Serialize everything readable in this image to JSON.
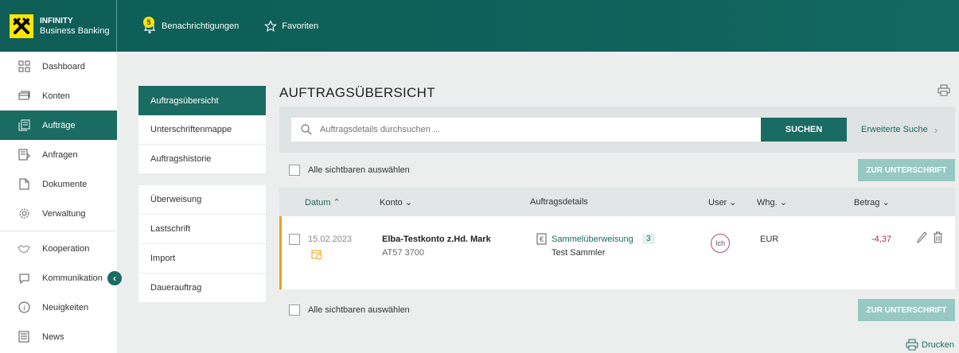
{
  "brand": {
    "line1": "INFINITY",
    "line2": "Business Banking"
  },
  "topnav": {
    "notifications_label": "Benachrichtigungen",
    "notifications_count": "5",
    "favorites_label": "Favoriten"
  },
  "sidebar": {
    "items": [
      {
        "label": "Dashboard",
        "icon": "dashboard-icon"
      },
      {
        "label": "Konten",
        "icon": "accounts-icon"
      },
      {
        "label": "Aufträge",
        "icon": "orders-icon",
        "active": true
      },
      {
        "label": "Anfragen",
        "icon": "requests-icon"
      },
      {
        "label": "Dokumente",
        "icon": "documents-icon"
      },
      {
        "label": "Verwaltung",
        "icon": "gear-icon"
      },
      {
        "label": "Kooperation",
        "icon": "handshake-icon"
      },
      {
        "label": "Kommunikation",
        "icon": "chat-icon"
      },
      {
        "label": "Neuigkeiten",
        "icon": "info-icon"
      },
      {
        "label": "News",
        "icon": "news-icon"
      }
    ]
  },
  "subnav": {
    "group1": [
      "Auftragsübersicht",
      "Unterschriftenmappe",
      "Auftragshistorie"
    ],
    "group2": [
      "Überweisung",
      "Lastschrift",
      "Import",
      "Dauerauftrag"
    ]
  },
  "main": {
    "title": "AUFTRAGSÜBERSICHT",
    "search_placeholder": "Auftragsdetails durchsuchen ...",
    "search_button": "SUCHEN",
    "advanced_search": "Erweiterte Suche",
    "select_all": "Alle sichtbaren auswählen",
    "sign_button": "ZUR UNTERSCHRIFT",
    "print_label": "Drucken"
  },
  "table": {
    "columns": {
      "date": "Datum",
      "account": "Konto",
      "details": "Auftragsdetails",
      "user": "User",
      "currency": "Whg.",
      "amount": "Betrag"
    },
    "rows": [
      {
        "date": "15.02.2023",
        "account_name": "Elba-Testkonto z.Hd. Mark",
        "account_number": "AT57 3700",
        "order_type": "Sammelüberweisung",
        "order_count": "3",
        "order_name": "Test Sammler",
        "user": "Ich",
        "currency": "EUR",
        "amount": "-4,37"
      }
    ]
  },
  "colors": {
    "primary": "#1a6b62",
    "accent_yellow": "#ffe500",
    "row_marker": "#e8a317",
    "negative_amount": "#c0283a",
    "disabled_button": "#97c8c2"
  }
}
